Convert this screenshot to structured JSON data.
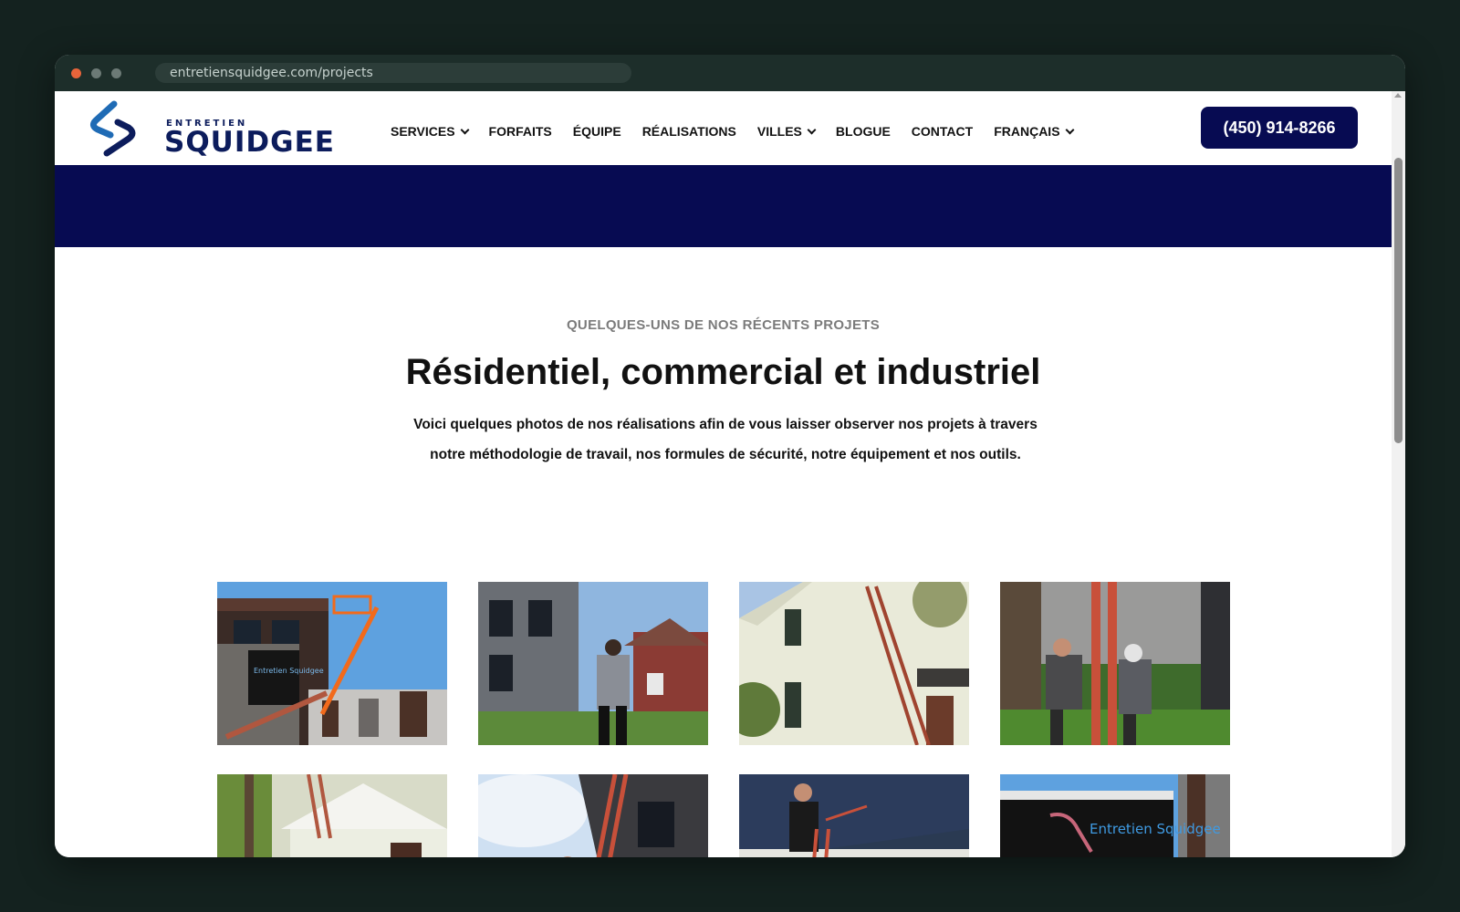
{
  "browser": {
    "url": "entretiensquidgee.com/projects"
  },
  "header": {
    "logo": {
      "small_text": "ENTRETIEN",
      "brand_text": "SQUIDGEE",
      "accent_color": "#1f6bb5",
      "brand_color": "#0c1c5c"
    },
    "nav": [
      {
        "label": "SERVICES",
        "has_dropdown": true
      },
      {
        "label": "FORFAITS",
        "has_dropdown": false
      },
      {
        "label": "ÉQUIPE",
        "has_dropdown": false
      },
      {
        "label": "RÉALISATIONS",
        "has_dropdown": false
      },
      {
        "label": "VILLES",
        "has_dropdown": true
      },
      {
        "label": "BLOGUE",
        "has_dropdown": false
      },
      {
        "label": "CONTACT",
        "has_dropdown": false
      },
      {
        "label": "FRANÇAIS",
        "has_dropdown": true
      }
    ],
    "phone_button": "(450) 914-8266",
    "brand_navy": "#070b52"
  },
  "section": {
    "eyebrow": "QUELQUES-UNS DE NOS RÉCENTS PROJETS",
    "title": "Résidentiel, commercial et industriel",
    "intro_line1": "Voici quelques photos de nos réalisations afin de vous laisser observer nos projets à travers",
    "intro_line2": "notre méthodologie de travail, nos formules de sécurité, notre équipement et nos outils."
  },
  "gallery": {
    "photos": [
      {
        "name": "aerial-lift-building-photo",
        "logo_text": "Entretien Squidgee"
      },
      {
        "name": "worker-facing-townhouses-photo"
      },
      {
        "name": "ladder-white-house-photo"
      },
      {
        "name": "two-workers-ladder-photo"
      },
      {
        "name": "white-house-entrance-photo"
      },
      {
        "name": "ladder-brick-wall-photo"
      },
      {
        "name": "worker-on-roof-photo"
      },
      {
        "name": "company-trailer-photo",
        "logo_text": "Entretien Squidgee"
      }
    ]
  }
}
